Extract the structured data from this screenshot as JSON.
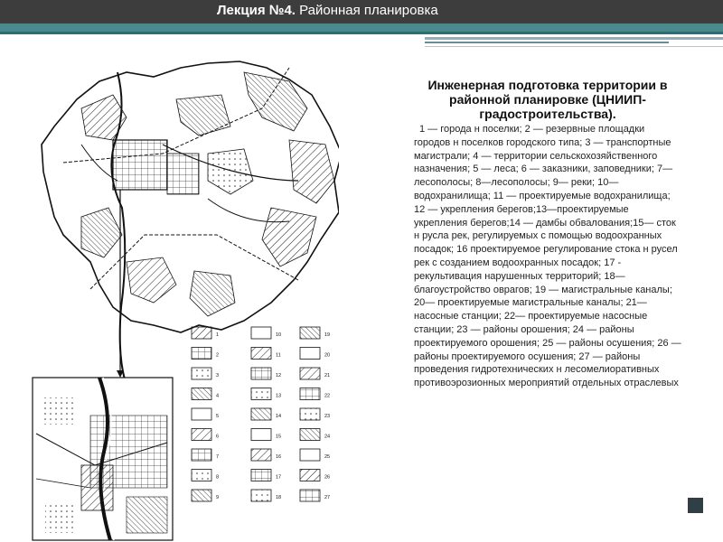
{
  "slide": {
    "title_bold": "Лекция №4.",
    "title_rest": " Районная планировка"
  },
  "content": {
    "heading": "Инженерная подготовка территории в районной планировке (ЦНИИП-градостроительства).",
    "body": "1 — города н поселки; 2 — резервные площадки городов н поселков городского типа; 3 — транспортные магистрали; 4 — территории сельскохозяйственного назначения; 5 — леса; 6 — заказники, заповедники; 7— лесополосы; 8—лесополосы; 9— реки; 10—водохранилища; 11 — проектируемые водохранилища; 12 — укрепления берегов;13—проектируемые укрепления берегов;14 — дамбы обвалования;15— сток н русла рек, регулируемых с помощью водоохранных посадок; 16 проектируемое регулирование стока н русел рек с созданием водоохранных посадок; 17  - рекультивация нарушенных территорий; 18—благоустройство оврагов; 19 — магистральные каналы; 20— проектируемые магистральные каналы; 21— насосные станции; 22— проектируемые насосные станции; 23 — районы орошения; 24 — районы проектируемого орошения; 25 — районы осушения; 26 — районы проектируемого осушения; 27 — районы проведения гидротехнических н лесомелиоративных противоэрозионных мероприятий отдельных отраслевых"
  },
  "figure": {
    "legend_numbers": [
      "1",
      "2",
      "3",
      "4",
      "5",
      "6",
      "7",
      "8",
      "9",
      "10",
      "11",
      "12",
      "13",
      "14",
      "15",
      "16",
      "17",
      "18",
      "19",
      "20",
      "21",
      "22",
      "23",
      "24",
      "25",
      "26",
      "27"
    ]
  },
  "colors": {
    "header_bg": "#3d3d3d",
    "accent_teal": "#4a8a8c",
    "nav_square": "#2f3f45"
  }
}
